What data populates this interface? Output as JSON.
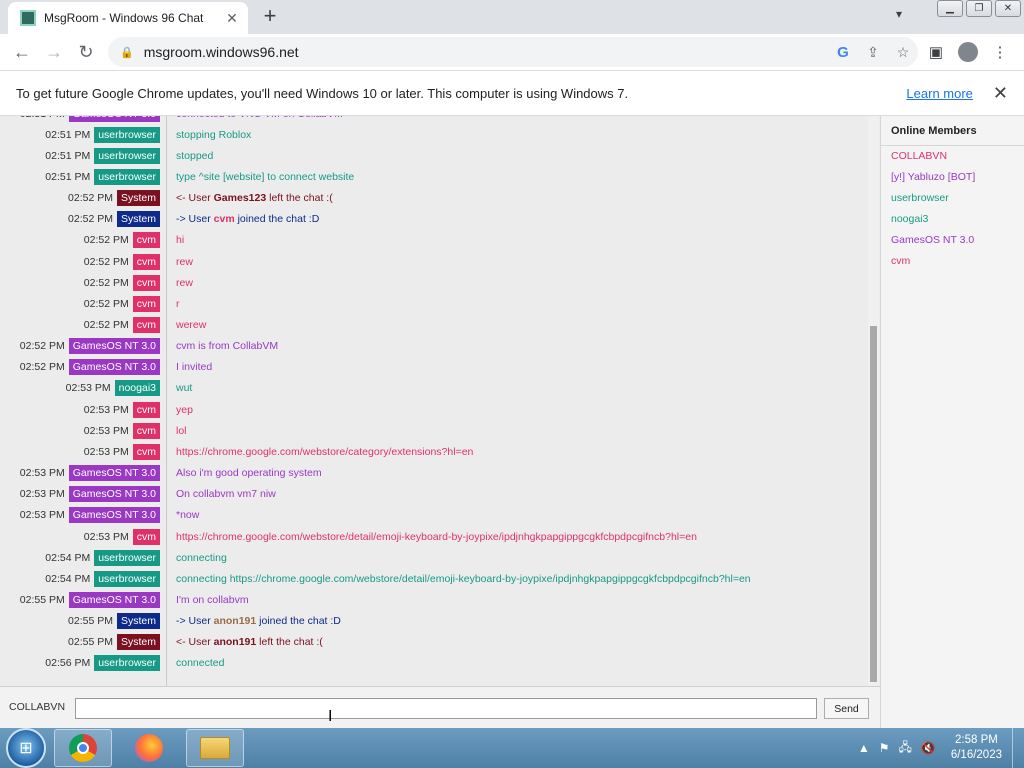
{
  "tab": {
    "title": "MsgRoom - Windows 96 Chat",
    "close": "✕"
  },
  "browser": {
    "new_tab": "+",
    "url": "msgroom.windows96.net",
    "back": "←",
    "forward": "→",
    "reload": "↻"
  },
  "infobar": {
    "text": "To get future Google Chrome updates, you'll need Windows 10 or later. This computer is using Windows 7.",
    "link": "Learn more",
    "close": "✕"
  },
  "colors": {
    "userbrowser": "#169a86",
    "System_join": "#0e2a8a",
    "System_left": "#7a1020",
    "cvm": "#e0306a",
    "GamesOS NT 3.0": "#9a38c4",
    "noogai3": "#169a86"
  },
  "messages": [
    {
      "time": "02:51 PM",
      "user": "GamesOS NT 3.0",
      "color": "#9a38c4",
      "text": "connected to VNC VM on CollabVM",
      "text_color": "#9a38c4"
    },
    {
      "time": "02:51 PM",
      "user": "userbrowser",
      "color": "#169a86",
      "text": "stopping Roblox",
      "text_color": "#169a86"
    },
    {
      "time": "02:51 PM",
      "user": "userbrowser",
      "color": "#169a86",
      "text": "stopped",
      "text_color": "#169a86"
    },
    {
      "time": "02:51 PM",
      "user": "userbrowser",
      "color": "#169a86",
      "text": "type ^site [website] to connect website",
      "text_color": "#169a86"
    },
    {
      "time": "02:52 PM",
      "user": "System",
      "color": "#7a1020",
      "text_pre": "<- User ",
      "text_bold": "Games123",
      "text_post": " left the chat :(",
      "text_color": "#7a1020",
      "bold_color": "#7a1020"
    },
    {
      "time": "02:52 PM",
      "user": "System",
      "color": "#0e2a8a",
      "text_pre": "-> User ",
      "text_bold": "cvm",
      "text_post": " joined the chat :D",
      "text_color": "#0e2a8a",
      "bold_color": "#e0306a"
    },
    {
      "time": "02:52 PM",
      "user": "cvm",
      "color": "#e0306a",
      "text": "hi",
      "text_color": "#e0306a"
    },
    {
      "time": "02:52 PM",
      "user": "cvm",
      "color": "#e0306a",
      "text": "rew",
      "text_color": "#e0306a"
    },
    {
      "time": "02:52 PM",
      "user": "cvm",
      "color": "#e0306a",
      "text": "rew",
      "text_color": "#e0306a"
    },
    {
      "time": "02:52 PM",
      "user": "cvm",
      "color": "#e0306a",
      "text": "r",
      "text_color": "#e0306a"
    },
    {
      "time": "02:52 PM",
      "user": "cvm",
      "color": "#e0306a",
      "text": "werew",
      "text_color": "#e0306a"
    },
    {
      "time": "02:52 PM",
      "user": "GamesOS NT 3.0",
      "color": "#9a38c4",
      "text": "cvm is from CollabVM",
      "text_color": "#9a38c4"
    },
    {
      "time": "02:52 PM",
      "user": "GamesOS NT 3.0",
      "color": "#9a38c4",
      "text": "I invited",
      "text_color": "#9a38c4"
    },
    {
      "time": "02:53 PM",
      "user": "noogai3",
      "color": "#169a86",
      "text": "wut",
      "text_color": "#169a86"
    },
    {
      "time": "02:53 PM",
      "user": "cvm",
      "color": "#e0306a",
      "text": "yep",
      "text_color": "#e0306a"
    },
    {
      "time": "02:53 PM",
      "user": "cvm",
      "color": "#e0306a",
      "text": "lol",
      "text_color": "#e0306a"
    },
    {
      "time": "02:53 PM",
      "user": "cvm",
      "color": "#e0306a",
      "text": "https://chrome.google.com/webstore/category/extensions?hl=en",
      "text_color": "#e0306a"
    },
    {
      "time": "02:53 PM",
      "user": "GamesOS NT 3.0",
      "color": "#9a38c4",
      "text": "Also i'm good operating system",
      "text_color": "#9a38c4"
    },
    {
      "time": "02:53 PM",
      "user": "GamesOS NT 3.0",
      "color": "#9a38c4",
      "text": "On collabvm vm7 niw",
      "text_color": "#9a38c4"
    },
    {
      "time": "02:53 PM",
      "user": "GamesOS NT 3.0",
      "color": "#9a38c4",
      "text": "*now",
      "text_color": "#9a38c4"
    },
    {
      "time": "02:53 PM",
      "user": "cvm",
      "color": "#e0306a",
      "text": "https://chrome.google.com/webstore/detail/emoji-keyboard-by-joypixe/ipdjnhgkpapgippgcgkfcbpdpcgifncb?hl=en",
      "text_color": "#e0306a"
    },
    {
      "time": "02:54 PM",
      "user": "userbrowser",
      "color": "#169a86",
      "text": "connecting",
      "text_color": "#169a86"
    },
    {
      "time": "02:54 PM",
      "user": "userbrowser",
      "color": "#169a86",
      "text": "connecting https://chrome.google.com/webstore/detail/emoji-keyboard-by-joypixe/ipdjnhgkpapgippgcgkfcbpdpcgifncb?hl=en",
      "text_color": "#169a86"
    },
    {
      "time": "02:55 PM",
      "user": "GamesOS NT 3.0",
      "color": "#9a38c4",
      "text": "I'm on collabvm",
      "text_color": "#9a38c4"
    },
    {
      "time": "02:55 PM",
      "user": "System",
      "color": "#0e2a8a",
      "text_pre": "-> User ",
      "text_bold": "anon191",
      "text_post": " joined the chat :D",
      "text_color": "#0e2a8a",
      "bold_color": "#9a6a4a"
    },
    {
      "time": "02:55 PM",
      "user": "System",
      "color": "#7a1020",
      "text_pre": "<- User ",
      "text_bold": "anon191",
      "text_post": " left the chat :(",
      "text_color": "#7a1020",
      "bold_color": "#7a1020"
    },
    {
      "time": "02:56 PM",
      "user": "userbrowser",
      "color": "#169a86",
      "text": "connected",
      "text_color": "#169a86"
    }
  ],
  "members": {
    "title": "Online Members",
    "items": [
      {
        "name": "COLLABVN",
        "color": "#e0306a"
      },
      {
        "name": "[y!] Yabluzo [BOT]",
        "color": "#9a38c4"
      },
      {
        "name": "userbrowser",
        "color": "#169a86"
      },
      {
        "name": "noogai3",
        "color": "#169a86"
      },
      {
        "name": "GamesOS NT 3.0",
        "color": "#9a38c4"
      },
      {
        "name": "cvm",
        "color": "#e0306a"
      }
    ]
  },
  "input": {
    "nick": "COLLABVN",
    "value": "",
    "send_label": "Send"
  },
  "taskbar": {
    "time": "2:58 PM",
    "date": "6/16/2023"
  }
}
